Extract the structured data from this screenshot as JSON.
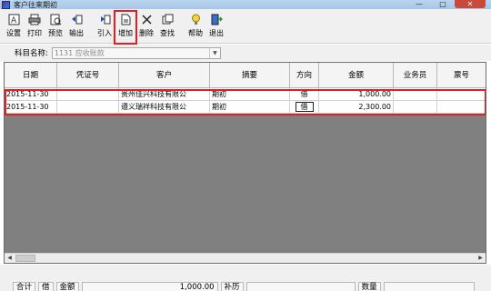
{
  "window": {
    "title": "客户往来期初",
    "controls": {
      "minimize": "—",
      "maximize": "□",
      "close": "✕"
    }
  },
  "toolbar": {
    "buttons": [
      {
        "id": "settings",
        "label": "设置",
        "icon": "settings-icon"
      },
      {
        "id": "print",
        "label": "打印",
        "icon": "printer-icon"
      },
      {
        "id": "preview",
        "label": "预览",
        "icon": "preview-icon"
      },
      {
        "id": "export",
        "label": "输出",
        "icon": "export-icon"
      },
      {
        "id": "import",
        "label": "引入",
        "icon": "import-icon"
      },
      {
        "id": "add",
        "label": "增加",
        "icon": "add-doc-icon"
      },
      {
        "id": "delete",
        "label": "删除",
        "icon": "delete-scissors-icon"
      },
      {
        "id": "find",
        "label": "查找",
        "icon": "find-icon"
      },
      {
        "id": "help",
        "label": "帮助",
        "icon": "help-bulb-icon"
      },
      {
        "id": "exit",
        "label": "退出",
        "icon": "exit-door-icon"
      }
    ]
  },
  "account": {
    "label": "科目名称:",
    "value": "1131 应收账款"
  },
  "grid": {
    "columns": [
      "日期",
      "凭证号",
      "客户",
      "摘要",
      "方向",
      "金额",
      "业务员",
      "票号"
    ],
    "rows": [
      {
        "date": "2015-11-30",
        "voucher": "",
        "customer": "贵州佳兴科技有限公",
        "summary": "期初",
        "direction": "借",
        "amount": "1,000.00",
        "salesperson": "",
        "ticket": ""
      },
      {
        "date": "2015-11-30",
        "voucher": "",
        "customer": "遵义瑞祥科技有限公",
        "summary": "期初",
        "direction": "借",
        "amount": "2,300.00",
        "salesperson": "",
        "ticket": ""
      }
    ]
  },
  "footer": {
    "total_label": "合计",
    "direction": "借",
    "amount_label": "金额",
    "amount_value": "1,000.00",
    "balance_label": "补历",
    "quantity_label": "数量"
  },
  "colors": {
    "highlight": "#e02020",
    "grid_bg": "#808080"
  }
}
